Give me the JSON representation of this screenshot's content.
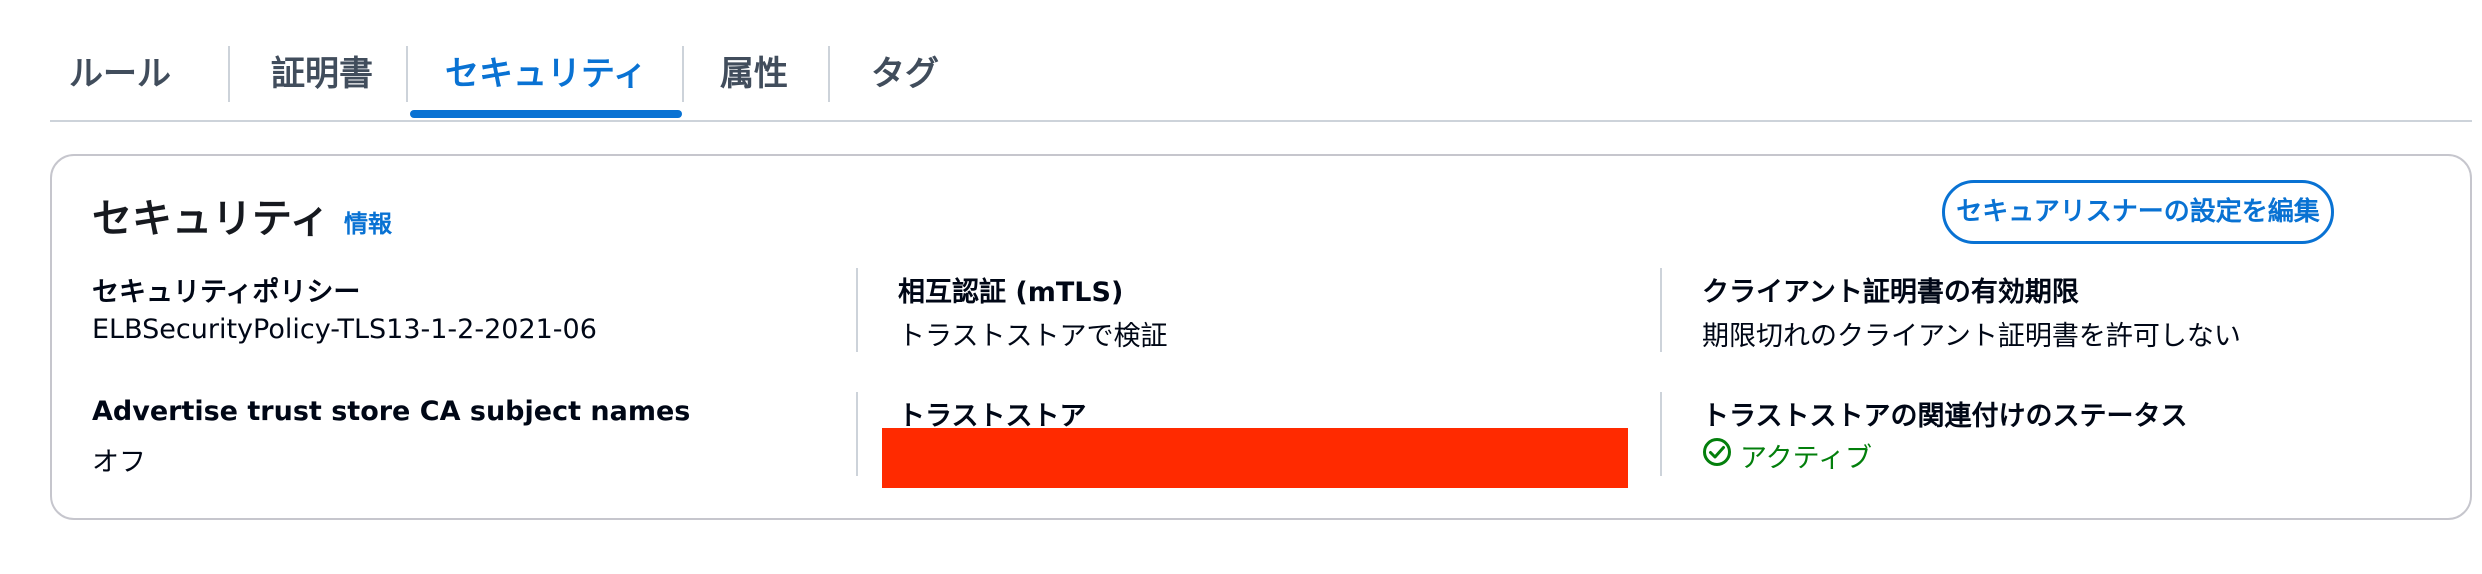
{
  "tabs": [
    {
      "label": "ルール"
    },
    {
      "label": "証明書"
    },
    {
      "label": "セキュリティ",
      "active": true
    },
    {
      "label": "属性"
    },
    {
      "label": "タグ"
    }
  ],
  "panel": {
    "title": "セキュリティ",
    "info_link": "情報",
    "edit_button": "セキュアリスナーの設定を編集",
    "fields": {
      "security_policy": {
        "label": "セキュリティポリシー",
        "value": "ELBSecurityPolicy-TLS13-1-2-2021-06"
      },
      "mtls": {
        "label": "相互認証 (mTLS)",
        "value": "トラストストアで検証"
      },
      "client_cert_expiry": {
        "label": "クライアント証明書の有効期限",
        "value": "期限切れのクライアント証明書を許可しない"
      },
      "advertise_ca": {
        "label": "Advertise trust store CA subject names",
        "value": "オフ"
      },
      "trust_store": {
        "label": "トラストストア",
        "value": ""
      },
      "trust_store_association": {
        "label": "トラストストアの関連付けのステータス",
        "value": "アクティブ",
        "status_icon": "check-circle-icon"
      }
    }
  },
  "colors": {
    "accent": "#0972d3",
    "success": "#037f0c",
    "redaction": "#ff2a00"
  }
}
